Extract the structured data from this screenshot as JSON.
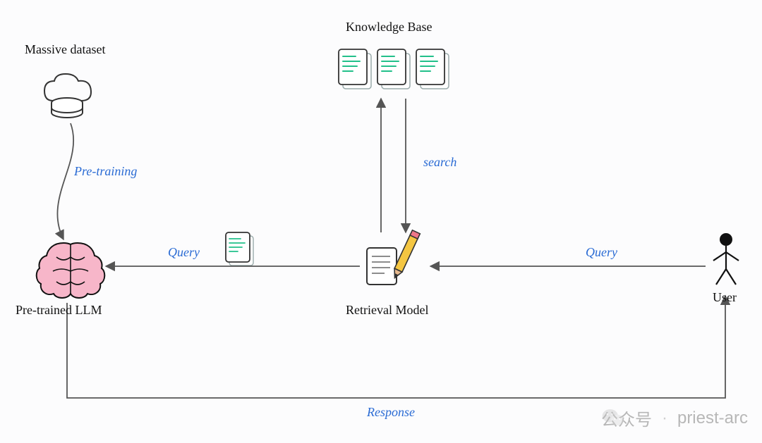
{
  "nodes": {
    "massive_dataset": "Massive dataset",
    "knowledge_base": "Knowledge Base",
    "pretrained_llm": "Pre-trained LLM",
    "retrieval_model": "Retrieval Model",
    "user": "User"
  },
  "edges": {
    "pretraining": "Pre-training",
    "search": "search",
    "query_from_user": "Query",
    "query_to_llm": "Query",
    "response": "Response"
  },
  "icons": {
    "dataset": "cloud-database-icon",
    "knowledge_base_docs": "document-stack-icon",
    "llm_brain": "brain-icon",
    "retrieval_pencil": "note-pencil-icon",
    "user_actor": "stick-figure-icon",
    "query_doc": "document-icon",
    "wechat": "wechat-icon"
  },
  "watermark": {
    "prefix": "公众号",
    "separator": "·",
    "name": "priest-arc"
  }
}
